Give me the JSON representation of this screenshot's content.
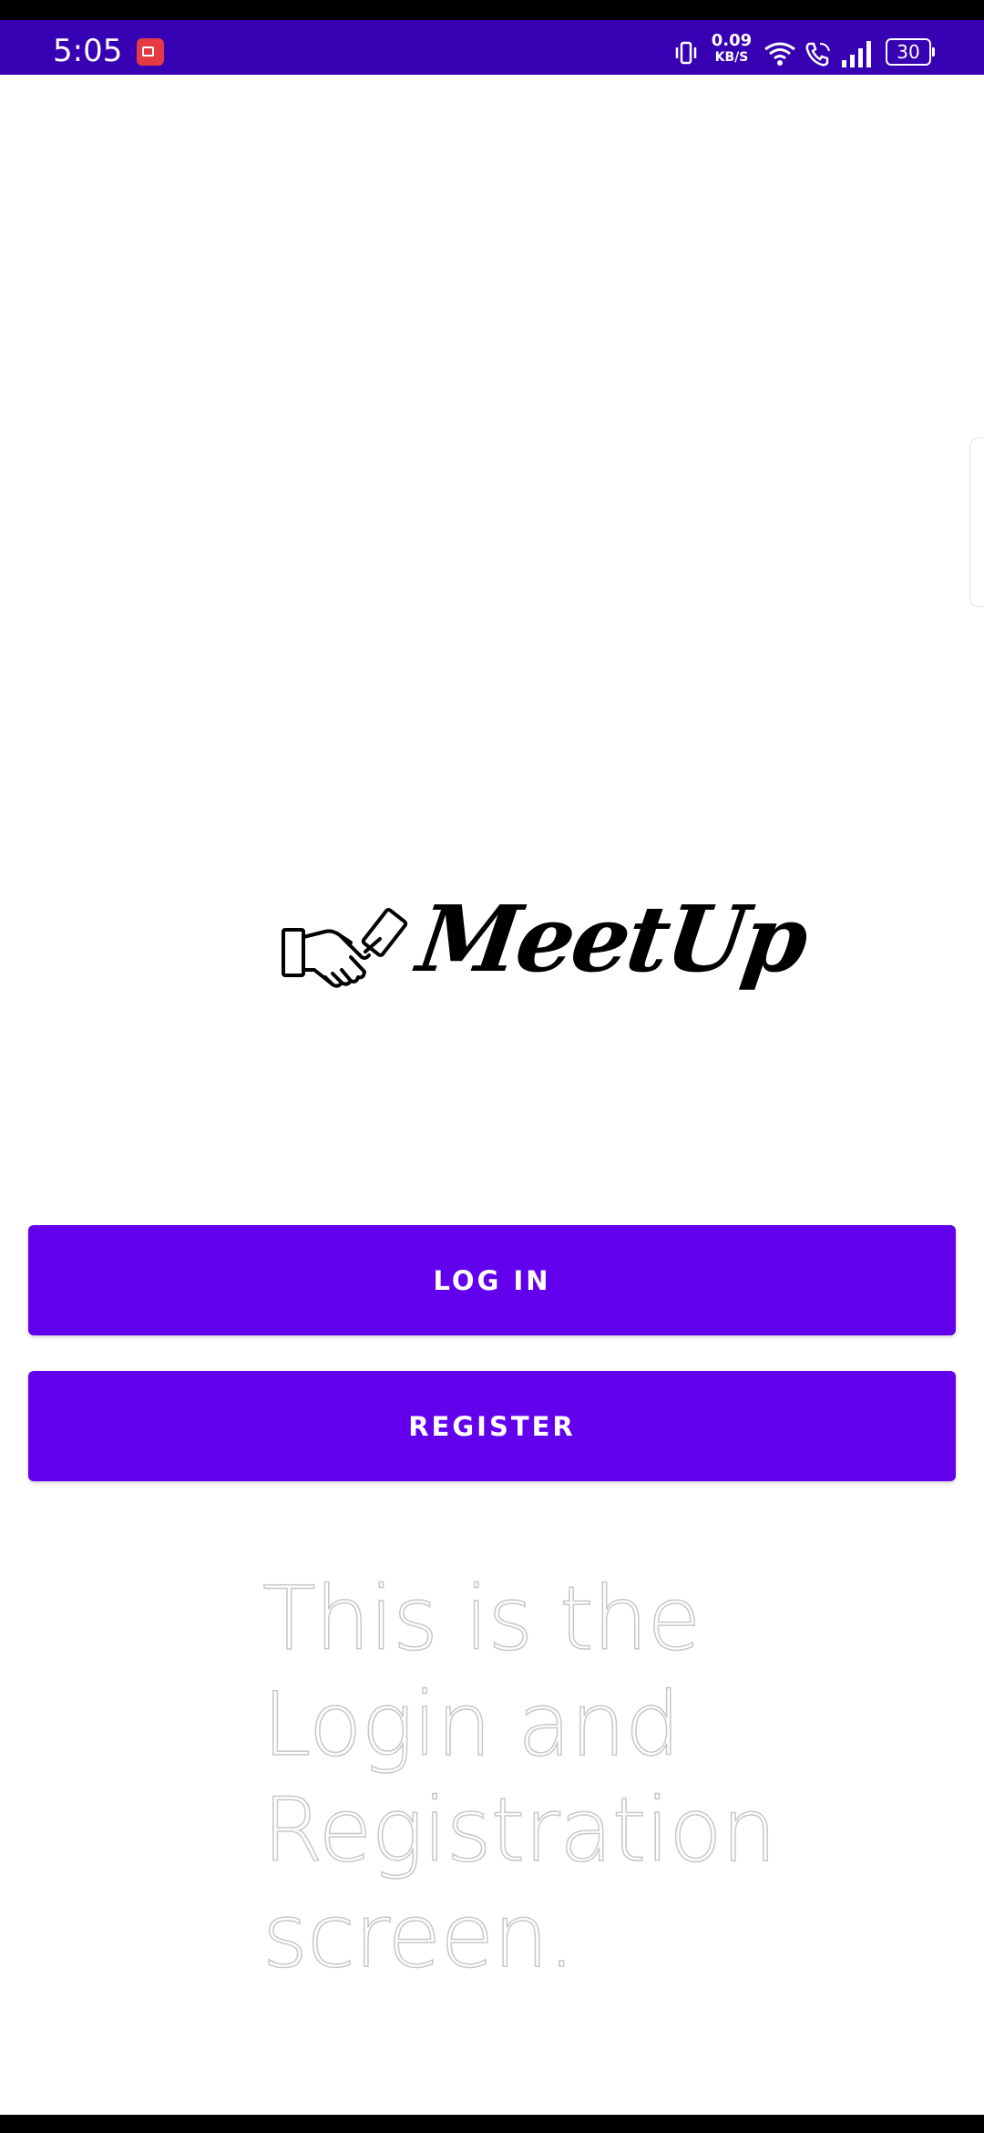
{
  "status_bar": {
    "time": "5:05",
    "net_speed_value": "0.09",
    "net_speed_unit": "KB/S",
    "battery": "30",
    "background_color": "#3700b3"
  },
  "app": {
    "logo_text": "MeetUp",
    "logo_icon": "handshake-icon",
    "accent_color": "#6200ee"
  },
  "buttons": {
    "login_label": "LOG IN",
    "register_label": "REGISTER"
  },
  "screen_note": "This is the Login and Registration screen."
}
